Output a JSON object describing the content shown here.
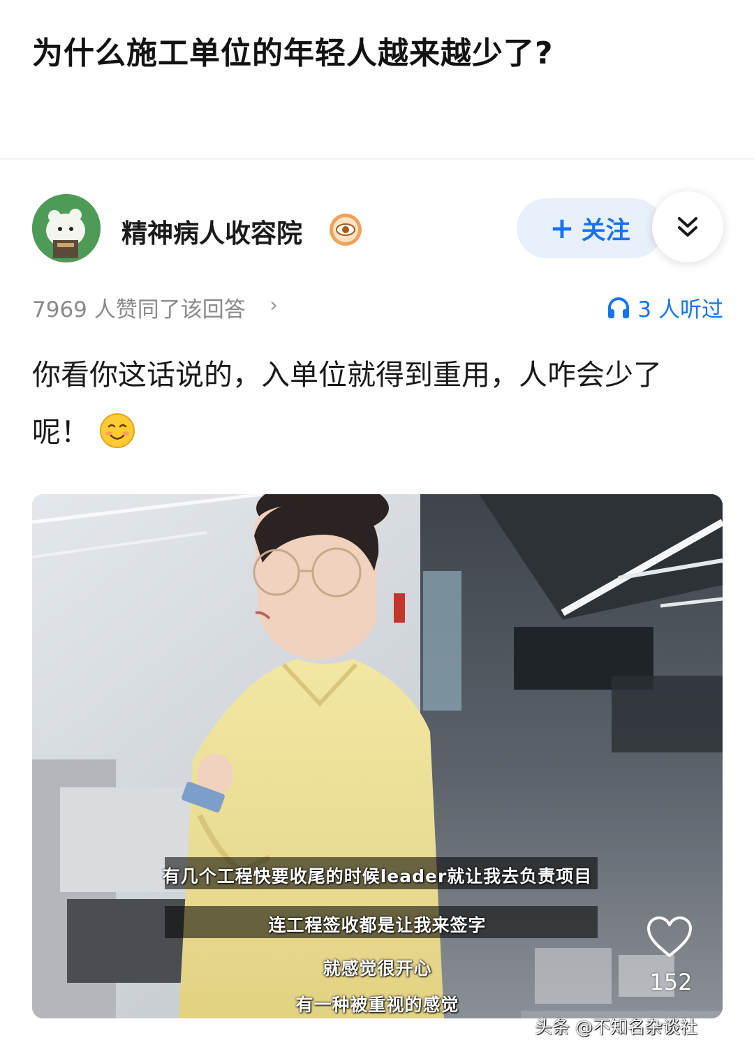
{
  "question": {
    "title": "为什么施工单位的年轻人越来越少了?"
  },
  "author": {
    "name": "精神病人收容院",
    "follow_label": "关注",
    "follow_plus": "+",
    "expand_icon": "double-chevron-down-icon",
    "badge_icon": "eye-badge-icon"
  },
  "meta": {
    "agree_text": "7969 人赞同了该回答",
    "agree_chevron": "›",
    "listened_text": "3 人听过",
    "listened_icon": "headphones-icon"
  },
  "answer": {
    "line1": "你看你这话说的，入单位就得到重用，人咋会少了",
    "line2": "呢！",
    "emoji": "smiling-face-icon"
  },
  "video": {
    "subtitles": [
      "有几个工程快要收尾的时候leader就让我去负责项目",
      "连工程签收都是让我来签字",
      "就感觉很开心",
      "有一种被重视的感觉"
    ],
    "like_count": "152",
    "like_icon": "heart-icon"
  },
  "watermark": "头条 @不知名杂谈社",
  "colors": {
    "accent": "#1772f6",
    "follow_bg": "#e8f0fb",
    "avatar_bg": "#4d9b57"
  }
}
